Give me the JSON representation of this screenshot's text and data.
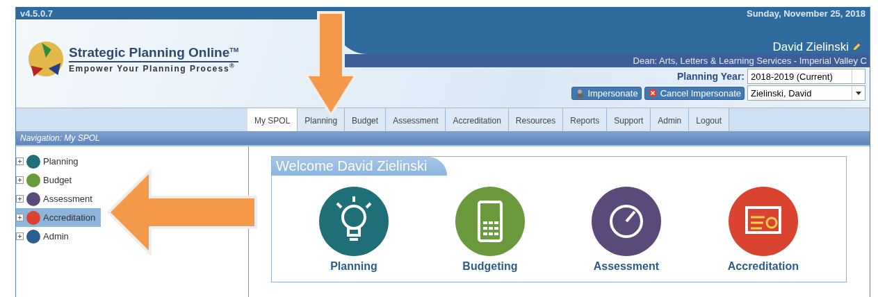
{
  "header": {
    "version": "v4.5.0.7",
    "date": "Sunday, November 25, 2018",
    "app_name": "Strategic Planning Online",
    "trademark": "TM",
    "tagline": "Empower Your Planning Process",
    "registered": "®",
    "user_name": "David Zielinski",
    "role": "Dean: Arts, Letters & Learning Services - Imperial Valley C",
    "planning_year_label": "Planning Year:",
    "planning_year": "2018-2019 (Current)",
    "impersonate_button": "Impersonate",
    "cancel_impersonate_button": "Cancel Impersonate",
    "impersonate_user": "Zielinski, David"
  },
  "menu": [
    {
      "label": "My SPOL",
      "selected": true
    },
    {
      "label": "Planning",
      "selected": false
    },
    {
      "label": "Budget",
      "selected": false
    },
    {
      "label": "Assessment",
      "selected": false
    },
    {
      "label": "Accreditation",
      "selected": false
    },
    {
      "label": "Resources",
      "selected": false
    },
    {
      "label": "Reports",
      "selected": false
    },
    {
      "label": "Support",
      "selected": false
    },
    {
      "label": "Admin",
      "selected": false
    },
    {
      "label": "Logout",
      "selected": false
    }
  ],
  "breadcrumb": "Navigation: My SPOL",
  "tree": [
    {
      "label": "Planning",
      "color": "#1e6f78",
      "selected": false
    },
    {
      "label": "Budget",
      "color": "#6b9a3c",
      "selected": false
    },
    {
      "label": "Assessment",
      "color": "#5a4a7a",
      "selected": false
    },
    {
      "label": "Accreditation",
      "color": "#d9432f",
      "selected": true
    },
    {
      "label": "Admin",
      "color": "#2b5e8c",
      "selected": false
    }
  ],
  "welcome": "Welcome David Zielinski",
  "tiles": [
    {
      "label": "Planning",
      "kind": "bulb",
      "color": "#1e6f78"
    },
    {
      "label": "Budgeting",
      "kind": "calculator",
      "color": "#6b9a3c"
    },
    {
      "label": "Assessment",
      "kind": "gauge",
      "color": "#5a4a7a"
    },
    {
      "label": "Accreditation",
      "kind": "certificate",
      "color": "#d9432f"
    }
  ]
}
